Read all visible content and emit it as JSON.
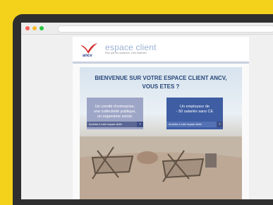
{
  "browser": {},
  "site": {
    "logo_text": "ancv",
    "brand": "espace client",
    "tagline": "Plus que les vacances, c'est essentiel"
  },
  "hero": {
    "headline_line1": "BIENVENUE SUR VOTRE ESPACE CLIENT ANCV,",
    "headline_line2": "VOUS ETES ?",
    "cards": [
      {
        "text_line1": "Un comité d'entreprise,",
        "text_line2": "une collectivité publique,",
        "text_line3": "un organisme social.",
        "button": "Accédez à votre espace dédié"
      },
      {
        "text_line1": "Un employeur de",
        "text_line2": "- 50 salariés sans CE",
        "button": "Accédez à votre espace dédié"
      }
    ]
  }
}
